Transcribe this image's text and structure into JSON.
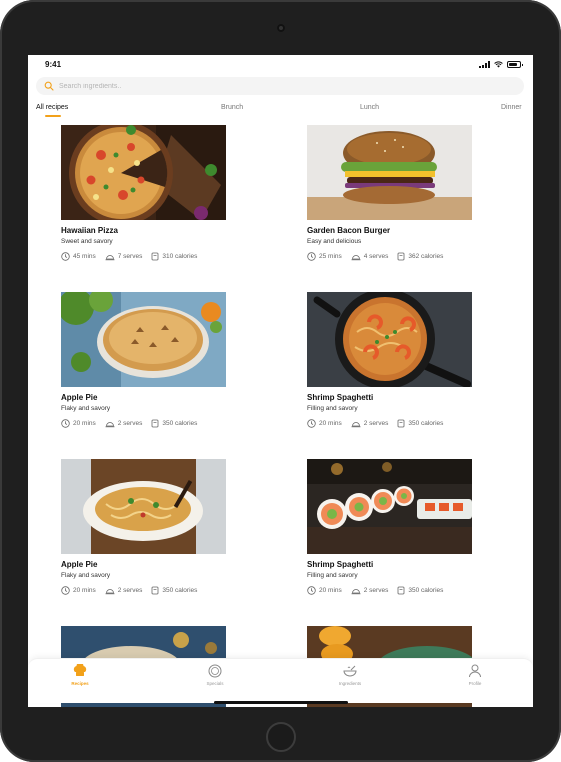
{
  "status_bar": {
    "time": "9:41"
  },
  "search": {
    "placeholder": "Search ingredients.."
  },
  "tabs": [
    {
      "label": "All recipes",
      "active": true
    },
    {
      "label": "Brunch",
      "active": false
    },
    {
      "label": "Lunch",
      "active": false
    },
    {
      "label": "Dinner",
      "active": false
    }
  ],
  "recipes": [
    {
      "title": "Hawaiian Pizza",
      "subtitle": "Sweet and savory",
      "time": "45 mins",
      "serves": "7 serves",
      "calories": "310 calories",
      "image": "pizza"
    },
    {
      "title": "Garden Bacon Burger",
      "subtitle": "Easy and delicious",
      "time": "25 mins",
      "serves": "4 serves",
      "calories": "362 calories",
      "image": "burger"
    },
    {
      "title": "Apple Pie",
      "subtitle": "Flaky and savory",
      "time": "20 mins",
      "serves": "2 serves",
      "calories": "350 calories",
      "image": "pie"
    },
    {
      "title": "Shrimp Spaghetti",
      "subtitle": "Filling and savory",
      "time": "20 mins",
      "serves": "2 serves",
      "calories": "350 calories",
      "image": "spaghetti"
    },
    {
      "title": "Apple Pie",
      "subtitle": "Flaky and savory",
      "time": "20 mins",
      "serves": "2 serves",
      "calories": "350 calories",
      "image": "noodle-soup"
    },
    {
      "title": "Shrimp Spaghetti",
      "subtitle": "Filling and savory",
      "time": "20 mins",
      "serves": "2 serves",
      "calories": "350 calories",
      "image": "sushi"
    }
  ],
  "bottom_nav": [
    {
      "label": "Recipes",
      "icon": "chef-hat-icon",
      "active": true
    },
    {
      "label": "Specials",
      "icon": "plate-icon",
      "active": false
    },
    {
      "label": "Ingredients",
      "icon": "bowl-icon",
      "active": false
    },
    {
      "label": "Profile",
      "icon": "user-icon",
      "active": false
    }
  ],
  "colors": {
    "accent": "#f2a11a",
    "text": "#111111",
    "muted": "#666666",
    "search_bg": "#f4f4f4"
  }
}
